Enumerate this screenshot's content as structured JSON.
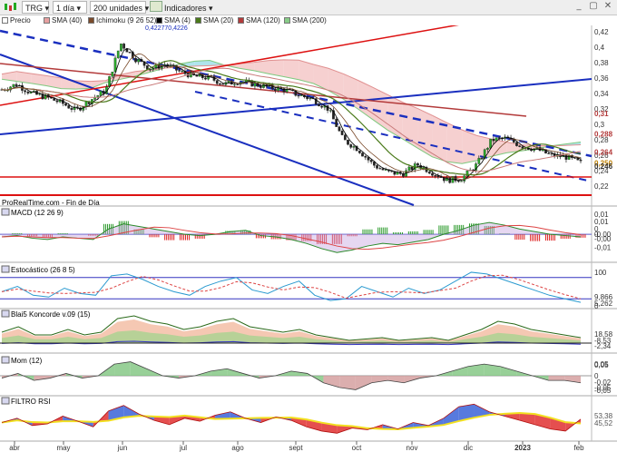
{
  "toolbar": {
    "ticker": "TRG",
    "interval": "1 día",
    "units": "200 unidades",
    "indicators_label": "Indicadores"
  },
  "legend": [
    {
      "label": "Precio",
      "color": "#000000"
    },
    {
      "label": "SMA (40)",
      "color": "#c97a7a"
    },
    {
      "label": "Ichimoku (9 26 52)",
      "color": "#7a4a2a"
    },
    {
      "label": "SMA (4)",
      "color": "#000000"
    },
    {
      "label": "SMA (20)",
      "color": "#4a7a1a"
    },
    {
      "label": "SMA (120)",
      "color": "#b33a3a"
    },
    {
      "label": "SMA (200)",
      "color": "#88cc88"
    }
  ],
  "footer_text": "ProRealTime.com - Fin de Día",
  "high_label": "0,422770,4226",
  "chart_data": [
    {
      "panel": "price",
      "type": "candlestick",
      "x_axis": [
        "abr",
        "may",
        "jun",
        "jul",
        "ago",
        "sept",
        "oct",
        "nov",
        "dic",
        "2023",
        "feb"
      ],
      "y_ticks": [
        "0,42",
        "0,4",
        "0,38",
        "0,36",
        "0,34",
        "0,32",
        "0,3",
        "0,28",
        "0,26",
        "0,24",
        "0,22"
      ],
      "ylim": [
        0.205,
        0.428
      ],
      "price_labels": [
        {
          "text": "0,31",
          "value": 0.314,
          "color": "#b33a3a"
        },
        {
          "text": "0,288",
          "value": 0.288,
          "color": "#b33a3a"
        },
        {
          "text": "0,264",
          "value": 0.264,
          "color": "#b33a3a"
        },
        {
          "text": "0,250",
          "value": 0.25,
          "color": "#c08000"
        },
        {
          "text": "0,246",
          "value": 0.246,
          "color": "#333333"
        }
      ],
      "close": [
        0.345,
        0.352,
        0.34,
        0.335,
        0.328,
        0.318,
        0.332,
        0.344,
        0.405,
        0.385,
        0.372,
        0.378,
        0.368,
        0.362,
        0.36,
        0.352,
        0.356,
        0.352,
        0.348,
        0.345,
        0.338,
        0.332,
        0.32,
        0.28,
        0.268,
        0.248,
        0.238,
        0.236,
        0.248,
        0.238,
        0.228,
        0.23,
        0.248,
        0.28,
        0.282,
        0.272,
        0.268,
        0.26,
        0.258,
        0.25
      ]
    },
    {
      "panel": "macd",
      "type": "line",
      "title": "MACD (12 26 9)",
      "y_ticks": [
        "0,01",
        "0",
        "-0,01"
      ],
      "ylim": [
        -0.018,
        0.014
      ],
      "values": [
        -0.002,
        -0.001,
        -0.003,
        -0.004,
        -0.002,
        -0.003,
        -0.004,
        0.004,
        0.008,
        0.006,
        0.004,
        0.002,
        0.0,
        -0.001,
        0.0,
        0.002,
        0.003,
        -0.001,
        -0.002,
        -0.004,
        -0.007,
        -0.011,
        -0.014,
        -0.012,
        -0.009,
        -0.007,
        -0.008,
        -0.006,
        -0.004,
        0.0,
        0.003,
        0.007,
        0.009,
        0.007,
        0.004,
        0.002,
        0.0,
        -0.001,
        -0.002
      ]
    },
    {
      "panel": "stochastic",
      "type": "line",
      "title": "Estocástico (26 8 5)",
      "y_ticks": [
        "100",
        "0"
      ],
      "ylim": [
        0,
        100
      ],
      "values": [
        40,
        55,
        30,
        25,
        50,
        35,
        30,
        85,
        90,
        75,
        55,
        40,
        30,
        55,
        70,
        80,
        45,
        35,
        55,
        70,
        30,
        15,
        20,
        55,
        40,
        25,
        50,
        35,
        45,
        70,
        95,
        90,
        75,
        60,
        45,
        30,
        20,
        10
      ]
    },
    {
      "panel": "blai5",
      "type": "area",
      "title": "Blai5 Koncorde v.09 (15)",
      "values": [
        0.4,
        0.6,
        0.3,
        0.3,
        0.5,
        0.3,
        0.4,
        0.9,
        1.0,
        0.8,
        0.7,
        0.5,
        0.6,
        0.8,
        0.9,
        0.6,
        0.5,
        0.4,
        0.5,
        0.3,
        0.2,
        0.1,
        0.15,
        0.2,
        0.1,
        0.15,
        0.2,
        0.1,
        0.3,
        0.5,
        0.8,
        0.7,
        0.5,
        0.4,
        0.3,
        0.2
      ]
    },
    {
      "panel": "momentum",
      "type": "area",
      "title": "Mom (12)",
      "y_ticks": [
        "0,05",
        "0",
        "-0,05"
      ],
      "ylim": [
        -0.07,
        0.07
      ],
      "values": [
        -0.01,
        0.01,
        -0.02,
        -0.01,
        0.01,
        -0.01,
        0.0,
        0.05,
        0.06,
        0.03,
        0.0,
        -0.01,
        0.0,
        0.02,
        0.03,
        0.01,
        -0.01,
        0.0,
        0.02,
        0.01,
        -0.03,
        -0.05,
        -0.06,
        -0.03,
        -0.02,
        -0.03,
        -0.01,
        0.0,
        0.02,
        0.04,
        0.05,
        0.04,
        0.02,
        0.0,
        -0.02,
        -0.02,
        -0.03
      ]
    },
    {
      "panel": "rsi_filter",
      "type": "line",
      "title": "FILTRO RSI",
      "values": [
        45,
        55,
        38,
        42,
        60,
        48,
        35,
        72,
        85,
        65,
        50,
        40,
        55,
        48,
        62,
        70,
        55,
        45,
        58,
        50,
        35,
        25,
        20,
        32,
        28,
        40,
        30,
        45,
        38,
        55,
        82,
        88,
        70,
        60,
        50,
        40,
        30,
        25,
        53
      ]
    }
  ],
  "right_labels": {
    "macd": [
      "0,01",
      "0",
      "-0,00",
      "-0,00"
    ],
    "stochastic": [
      "100",
      "9,866",
      "5,262",
      "0"
    ],
    "blai5": [
      "18,58",
      "-8,53",
      "-2,34"
    ],
    "momentum": [
      "0,05",
      "-0,02",
      "-0,05"
    ],
    "rsi": [
      "53,38",
      "45,52"
    ]
  }
}
